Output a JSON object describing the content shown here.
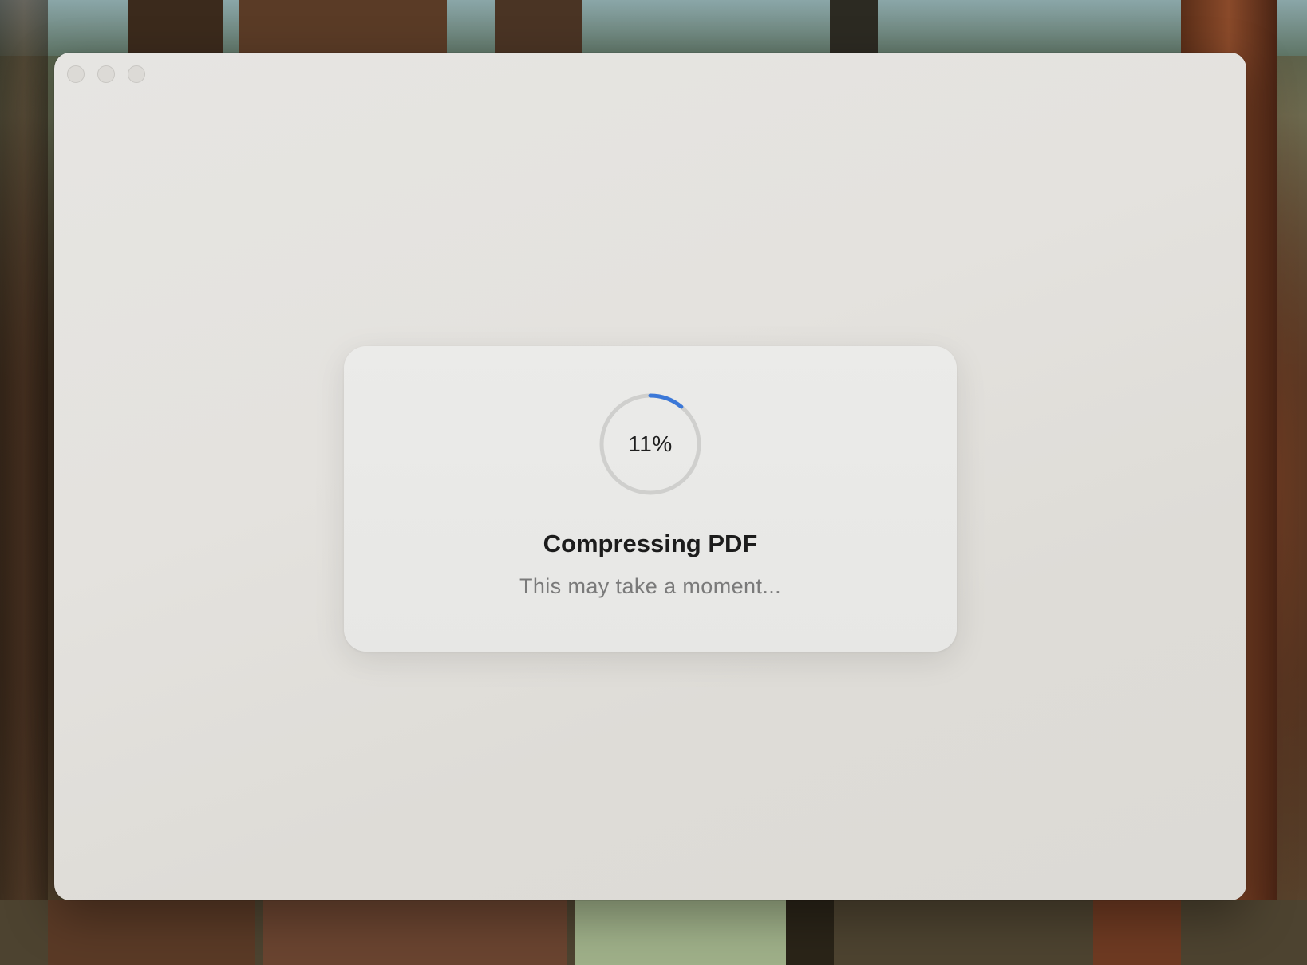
{
  "dialog": {
    "progress_percent": 11,
    "progress_label": "11%",
    "title": "Compressing PDF",
    "subtitle": "This may take a moment..."
  },
  "colors": {
    "progress_accent": "#3b78d8",
    "progress_track": "#cfcfcd"
  },
  "icons": {
    "window_controls": [
      "close-button",
      "minimize-button",
      "zoom-button"
    ]
  }
}
